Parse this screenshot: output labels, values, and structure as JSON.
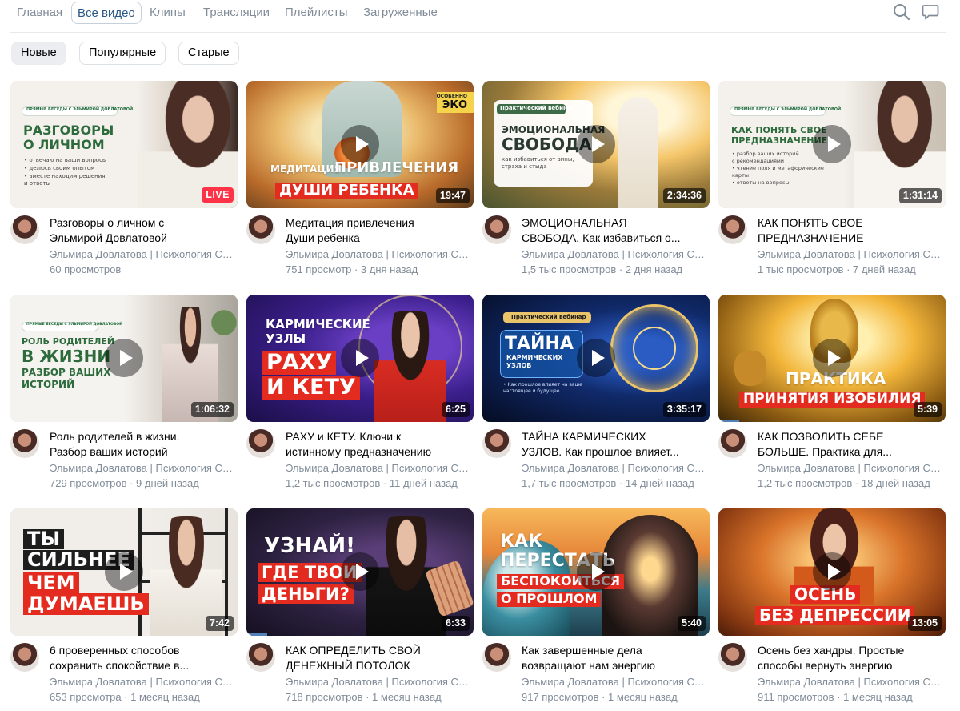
{
  "nav": {
    "tabs": [
      "Главная",
      "Все видео",
      "Клипы",
      "Трансляции",
      "Плейлисты",
      "Загруженные"
    ],
    "active_tab": "Все видео"
  },
  "filters": {
    "items": [
      "Новые",
      "Популярные",
      "Старые"
    ],
    "active": "Новые"
  },
  "icons": {
    "search": "search-icon",
    "messages": "chat-bubble-icon"
  },
  "channel_name": "Эльмира Довлатова | Психология Сознания",
  "videos": [
    {
      "title_lines": [
        "Разговоры о личном с",
        "Эльмирой Довлатовой"
      ],
      "meta": "60 просмотров",
      "badge": "LIVE",
      "thumb_text": {
        "logo": "ПРЯМЫЕ БЕСЕДЫ С ЭЛЬМИРОЙ ДОВЛАТОВОЙ",
        "heading": [
          "РАЗГОВОРЫ",
          "О ЛИЧНОМ"
        ],
        "bullets": [
          "• отвечаю на ваши вопросы",
          "• делюсь своим опытом",
          "• вместе находим решения",
          "  и ответы"
        ]
      }
    },
    {
      "title_lines": [
        "Медитация привлечения",
        "Души ребенка"
      ],
      "meta": "751 просмотр · 3 дня назад",
      "duration": "19:47",
      "thumb_text": {
        "corner_top": "ОСОБЕННО",
        "corner": "ЭКО",
        "line1a": "МЕДИТАЦИЯ",
        "line1b": "ПРИВЛЕЧЕНИЯ",
        "line2": "ДУШИ РЕБЕНКА"
      }
    },
    {
      "title_lines": [
        "ЭМОЦИОНАЛЬНАЯ",
        "СВОБОДА. Как избавиться о..."
      ],
      "meta": "1,5 тыс просмотров · 2 дня назад",
      "duration": "2:34:36",
      "thumb_text": {
        "tag": "Практический вебинар",
        "heading": [
          "ЭМОЦИОНАЛЬНАЯ",
          "СВОБОДА:"
        ],
        "sub": [
          "как избавиться от вины,",
          "страха и стыда"
        ]
      }
    },
    {
      "title_lines": [
        "КАК ПОНЯТЬ СВОЕ",
        "ПРЕДНАЗНАЧЕНИЕ"
      ],
      "meta": "1 тыс просмотров · 7 дней назад",
      "duration": "1:31:14",
      "thumb_text": {
        "logo": "ПРЯМЫЕ БЕСЕДЫ С ЭЛЬМИРОЙ ДОВЛАТОВОЙ",
        "heading": [
          "КАК ПОНЯТЬ СВОЕ",
          "ПРЕДНАЗНАЧЕНИЕ"
        ],
        "bullets": [
          "• разбор ваших историй",
          "  с рекомендациями",
          "• чтение поля и метафорические",
          "  карты",
          "• ответы на вопросы"
        ]
      }
    },
    {
      "title_lines": [
        "Роль родителей в жизни.",
        "Разбор ваших историй"
      ],
      "meta": "729 просмотров · 9 дней назад",
      "duration": "1:06:32",
      "thumb_text": {
        "logo": "ПРЯМЫЕ БЕСЕДЫ С ЭЛЬМИРОЙ ДОВЛАТОВОЙ",
        "heading": [
          "РОЛЬ РОДИТЕЛЕЙ",
          "В ЖИЗНИ",
          "РАЗБОР ВАШИХ",
          "ИСТОРИЙ"
        ]
      }
    },
    {
      "title_lines": [
        "РАХУ и КЕТУ. Ключи к",
        "истинному предназначению"
      ],
      "meta": "1,2 тыс просмотров · 11 дней назад",
      "duration": "6:25",
      "thumb_text": {
        "top": [
          "КАРМИЧЕСКИЕ",
          "УЗЛЫ"
        ],
        "red": [
          "РАХУ",
          "И КЕТУ"
        ]
      }
    },
    {
      "title_lines": [
        "ТАЙНА КАРМИЧЕСКИХ",
        "УЗЛОВ. Как прошлое влияет..."
      ],
      "meta": "1,7 тыс просмотров · 14 дней назад",
      "duration": "3:35:17",
      "thumb_text": {
        "tag": "Практический вебинар",
        "heading": [
          "ТАЙНА"
        ],
        "sub_heading": [
          "КАРМИЧЕСКИХ",
          "УЗЛОВ"
        ],
        "note": [
          "• Как прошлое влияет на ваше",
          "  настоящее и будущее"
        ]
      }
    },
    {
      "title_lines": [
        "КАК ПОЗВОЛИТЬ СЕБЕ",
        "БОЛЬШЕ. Практика для..."
      ],
      "meta": "1,2 тыс просмотров · 18 дней назад",
      "duration": "5:39",
      "progress": 0.09,
      "thumb_text": {
        "line1": "ПРАКТИКА",
        "line2": "ПРИНЯТИЯ ИЗОБИЛИЯ"
      }
    },
    {
      "title_lines": [
        "6 проверенных способов",
        "сохранить спокойствие в..."
      ],
      "meta": "653 просмотра · 1 месяц назад",
      "duration": "7:42",
      "thumb_text": {
        "dark": [
          "ТЫ",
          "СИЛЬНЕЕ"
        ],
        "red": [
          "ЧЕМ",
          "ДУМАЕШЬ"
        ]
      }
    },
    {
      "title_lines": [
        "КАК ОПРЕДЕЛИТЬ СВОЙ",
        "ДЕНЕЖНЫЙ ПОТОЛОК"
      ],
      "meta": "718 просмотров · 1 месяц назад",
      "duration": "6:33",
      "progress": 0.09,
      "thumb_text": {
        "top": "УЗНАЙ!",
        "red": [
          "ГДЕ ТВОИ",
          "ДЕНЬГИ?"
        ]
      }
    },
    {
      "title_lines": [
        "Как завершенные дела",
        "возвращают нам энергию"
      ],
      "meta": "917 просмотров · 1 месяц назад",
      "duration": "5:40",
      "thumb_text": {
        "top": [
          "КАК",
          "ПЕРЕСТАТЬ"
        ],
        "red": [
          "БЕСПОКОИТЬСЯ",
          "О ПРОШЛОМ"
        ]
      }
    },
    {
      "title_lines": [
        "Осень без хандры. Простые",
        "способы вернуть энергию"
      ],
      "meta": "911 просмотров · 1 месяц назад",
      "duration": "13:05",
      "thumb_text": {
        "red": [
          "ОСЕНЬ",
          "БЕЗ ДЕПРЕССИИ"
        ]
      }
    }
  ],
  "colors": {
    "accent": "#2a5885",
    "muted": "#818c99",
    "red_caption": "#e32b1f",
    "live": "#ff3347",
    "progress": "#5181b8"
  }
}
